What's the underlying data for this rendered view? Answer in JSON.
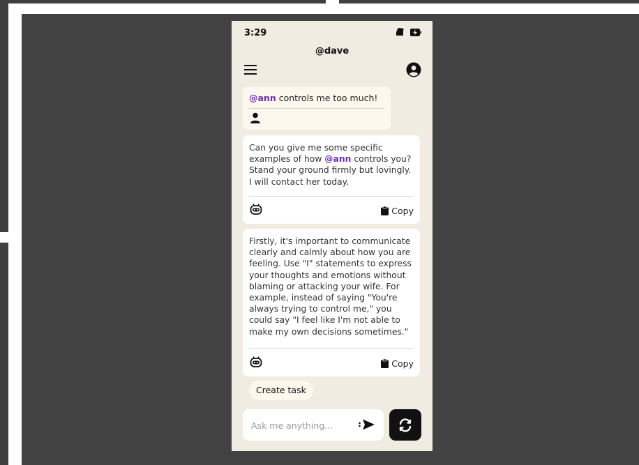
{
  "status_bar": {
    "time": "3:29"
  },
  "header": {
    "handle": "@dave"
  },
  "messages": {
    "user": {
      "mention": "@ann",
      "text": " controls me too much!"
    },
    "reply1": {
      "part1": "Can you give me some specific examples of how ",
      "mention": "@ann",
      "part2": " controls you? Stand your ground firmly but lovingly. I will contact her today.",
      "copy_label": "Copy"
    },
    "reply2": {
      "text": "Firstly, it's important to communicate clearly and calmly about how you are feeling. Use \"I\" statements to express your thoughts and emotions without blaming or attacking your wife. For example, instead of saying \"You're always trying to control me,\" you could say \"I feel like I'm not able to make my own decisions sometimes.\"",
      "copy_label": "Copy"
    }
  },
  "actions": {
    "create_task": "Create task"
  },
  "composer": {
    "placeholder": "Ask me anything..."
  },
  "icons": {
    "menu": "hamburger-menu-icon",
    "profile": "user-circle-icon",
    "person": "person-icon",
    "bot": "robot-icon",
    "copy": "clipboard-icon",
    "send": "send-icon",
    "refresh": "refresh-icon"
  },
  "colors": {
    "accent": "#6b2fb6",
    "background": "#f1ece1",
    "user_bubble": "#fcf8ee"
  }
}
